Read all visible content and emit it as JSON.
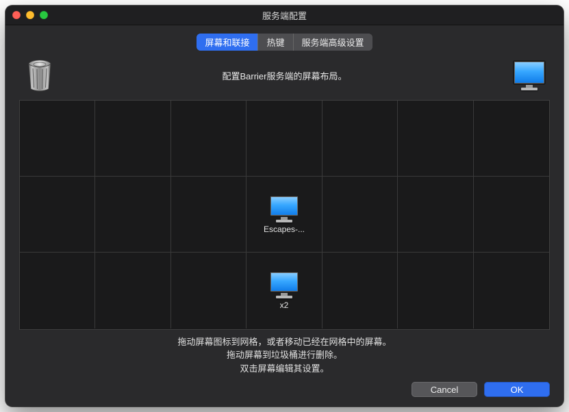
{
  "window": {
    "title": "服务端配置"
  },
  "tabs": [
    {
      "label": "屏幕和联接",
      "active": true
    },
    {
      "label": "热键",
      "active": false
    },
    {
      "label": "服务端高级设置",
      "active": false
    }
  ],
  "instruction": "配置Barrier服务端的屏幕布局。",
  "grid": {
    "cols": 7,
    "rows": 3,
    "screens": [
      {
        "col": 4,
        "row": 2,
        "label": "Escapes-..."
      },
      {
        "col": 4,
        "row": 3,
        "label": "x2"
      }
    ]
  },
  "help": {
    "line1": "拖动屏幕图标到网格，或者移动已经在网格中的屏幕。",
    "line2": "拖动屏幕到垃圾桶进行删除。",
    "line3": "双击屏幕编辑其设置。"
  },
  "buttons": {
    "cancel": "Cancel",
    "ok": "OK"
  },
  "icons": {
    "trash": "trash-icon",
    "monitor": "monitor-icon"
  }
}
